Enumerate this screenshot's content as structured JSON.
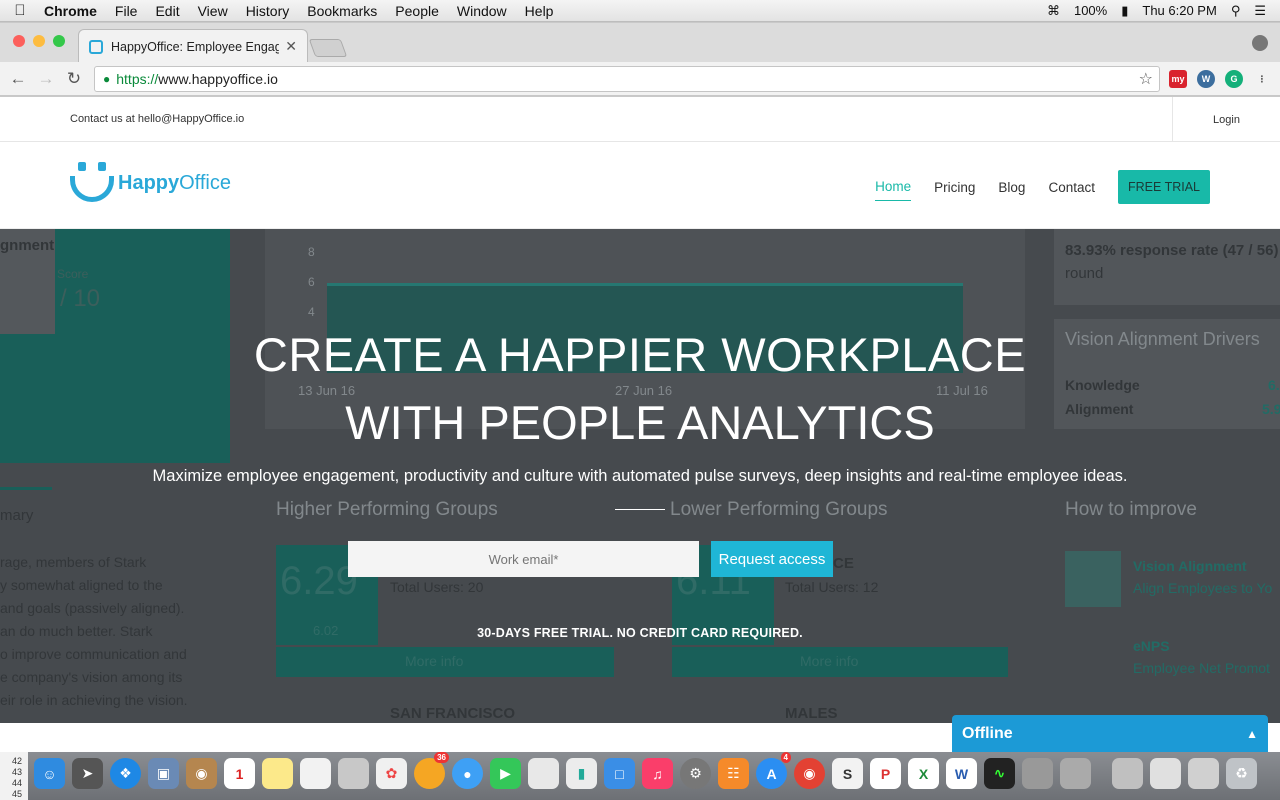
{
  "menubar": {
    "app": "Chrome",
    "items": [
      "File",
      "Edit",
      "View",
      "History",
      "Bookmarks",
      "People",
      "Window",
      "Help"
    ],
    "battery": "100%",
    "clock": "Thu 6:20 PM"
  },
  "tab": {
    "title": "HappyOffice: Employee Engag"
  },
  "address": {
    "https": "https://",
    "host": "www.happyoffice.io"
  },
  "extensions": [
    "my"
  ],
  "top": {
    "contact": "Contact us at hello@HappyOffice.io",
    "login": "Login"
  },
  "logo": {
    "happy": "Happy",
    "office": "Office"
  },
  "nav": {
    "home": "Home",
    "pricing": "Pricing",
    "blog": "Blog",
    "contact": "Contact",
    "trial": "FREE TRIAL"
  },
  "hero": {
    "line1": "CREATE A HAPPIER WORKPLACE",
    "line2": "WITH PEOPLE ANALYTICS",
    "subtitle": "Maximize employee engagement, productivity and culture with automated pulse surveys, deep insights and real-time employee ideas.",
    "email_placeholder": "Work email*",
    "request_button": "Request access",
    "note": "30-DAYS FREE TRIAL. NO CREDIT CARD REQUIRED."
  },
  "background": {
    "alignment": "gnment",
    "score_label": "Score",
    "score": "/ 10",
    "response_rate": "83.93% response rate (47 / 56)",
    "round": "round",
    "drivers_title": "Vision Alignment Drivers",
    "knowledge": "Knowledge",
    "alignment_label": "Alignment",
    "knowledge_value": "6.",
    "alignment_value": "5.9",
    "axis_8": "8",
    "axis_6": "6",
    "axis_4": "4",
    "date1": "13 Jun 16",
    "date2": "27 Jun 16",
    "date3": "11 Jul 16",
    "higher": "Higher Performing Groups",
    "lower": "Lower Performing Groups",
    "how": "How to improve",
    "summary": "mary",
    "big1": "6.29",
    "big1_sub": "6.02",
    "big2": "6.11",
    "total1": "Total Users: 20",
    "total2": "Total Users: 12",
    "ce": "CE",
    "more_info": "More info",
    "sf": "SAN FRANCISCO",
    "males": "MALES",
    "va_title": "Vision Alignment",
    "va_sub": "Align Employees to Yo",
    "enps_title": "eNPS",
    "enps_sub": "Employee Net Promot",
    "para": [
      "rage, members of Stark",
      "y somewhat aligned to the",
      "and goals (passively aligned).",
      "an do much better. Stark",
      "o improve communication and",
      "e company's vision among its",
      "eir role in achieving the vision."
    ]
  },
  "chat": {
    "status": "Offline"
  },
  "dock": {
    "side_numbers": [
      "42",
      "43",
      "44",
      "45"
    ],
    "badge_36": "36",
    "badge_4": "4"
  }
}
